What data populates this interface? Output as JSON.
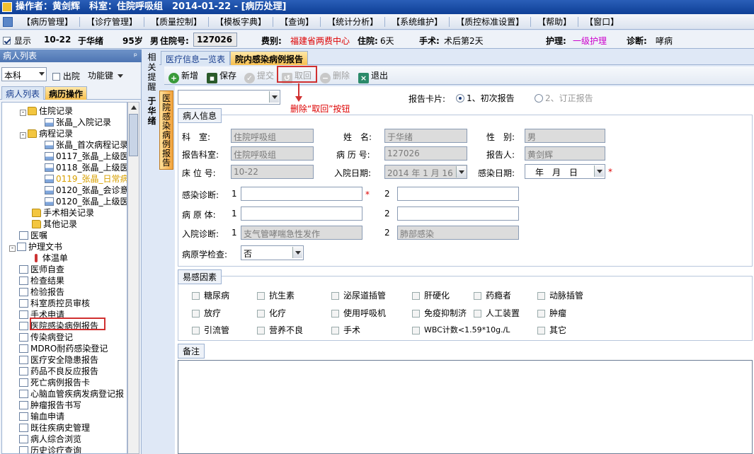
{
  "titlebar": {
    "text": "操作者：黄剑辉　科室：住院呼吸组　2014-01-22 - [病历处理]"
  },
  "menu": [
    "【病历管理】",
    "【诊疗管理】",
    "【质量控制】",
    "【模板字典】",
    "【查询】",
    "【统计分析】",
    "【系统维护】",
    "【质控标准设置】",
    "【帮助】",
    "【窗口】"
  ],
  "infobar": {
    "show_label": "显示",
    "bed": "10-22",
    "name": "于华绪",
    "age": "95岁",
    "gender": "男",
    "pid_label": "住院号:",
    "pid": "127026",
    "fee_label": "费别:",
    "fee": "福建省两费中心",
    "stay_label": "住院:",
    "stay": "6天",
    "surgery_label": "手术:",
    "surgery": "术后第2天",
    "nursing_label": "护理:",
    "nursing": "一级护理",
    "diag_label": "诊断:",
    "diag": "哮病"
  },
  "left": {
    "header": "病人列表",
    "pin": "ᵖ",
    "dept": "本科",
    "discharge": "出院",
    "funckey": "功能键",
    "tabs": [
      "病人列表",
      "病历操作"
    ],
    "tree": [
      "住院记录",
      "张晶_入院记录",
      "病程记录",
      "张晶_首次病程记录",
      "0117_张晶_上级医",
      "0118_张晶_上级医",
      "0119_张晶_日常病",
      "0120_张晶_会诊意",
      "0120_张晶_上级医",
      "手术相关记录",
      "其他记录",
      "医嘱",
      "护理文书",
      "体温单",
      "医师自查",
      "检查结果",
      "检验报告",
      "科室质控员审核",
      "手术申请",
      "医院感染病例报告",
      "传染病登记",
      "MDRO耐药感染登记",
      "医疗安全隐患报告",
      "药品不良反应报告",
      "死亡病例报告卡",
      "心脑血管疾病发病登记报",
      "肿瘤报告书写",
      "输血申请",
      "既往疾病史管理",
      "病人综合浏览",
      "历史诊疗查询"
    ]
  },
  "vtabs": {
    "remind": "相关提醒",
    "name": "于华绪",
    "report": "医院感染病例报告"
  },
  "toptabs": [
    "医疗信息一览表",
    "院内感染病例报告"
  ],
  "toolbar": {
    "new": "新增",
    "save": "保存",
    "submit": "提交",
    "retract": "取回",
    "delete": "删除",
    "exit": "退出"
  },
  "annotation": "删除“取回”按钮",
  "form": {
    "card_label": "报告卡片:",
    "card_opt1": "1、初次报告",
    "card_opt2": "2、订正报告",
    "patient_group": "病人信息",
    "dept_label": "科　室:",
    "dept_value": "住院呼吸组",
    "name_label": "姓　名:",
    "name_value": "于华绪",
    "gender_label": "性　别:",
    "gender_value": "男",
    "report_dept_label": "报告科室:",
    "report_dept_value": "住院呼吸组",
    "record_no_label": "病 历 号:",
    "record_no_value": "127026",
    "reporter_label": "报告人:",
    "reporter_value": "黄剑辉",
    "bed_label": "床 位 号:",
    "bed_value": "10-22",
    "admit_date_label": "入院日期:",
    "admit_date_value": "2014 年 1 月 16 日",
    "infect_date_label": "感染日期:",
    "infect_date_value": "年　月　日",
    "infect_diag_label": "感染诊断:",
    "pathogen_label": "病 原 体:",
    "admit_diag_label": "入院诊断:",
    "admit_diag1": "支气管哮喘急性发作",
    "admit_diag2": "肺部感染",
    "num1": "1",
    "num2": "2",
    "pathogen_test_label": "病原学检查:",
    "pathogen_test_value": "否",
    "risk_group": "易感因素",
    "risk_factors": [
      "糖尿病",
      "抗生素",
      "泌尿道插管",
      "肝硬化",
      "药瘾者",
      "动脉插管",
      "放疗",
      "化疗",
      "使用呼吸机",
      "免疫抑制济",
      "人工装置",
      "肿瘤",
      "引流管",
      "营养不良",
      "手术",
      "WBC计数<1.59*10g./L",
      "其它"
    ],
    "remarks_group": "备注"
  },
  "colors": {
    "title_bg": "#0e3f96",
    "tab_active": "#f7c04f",
    "alert_red": "#d03030"
  }
}
